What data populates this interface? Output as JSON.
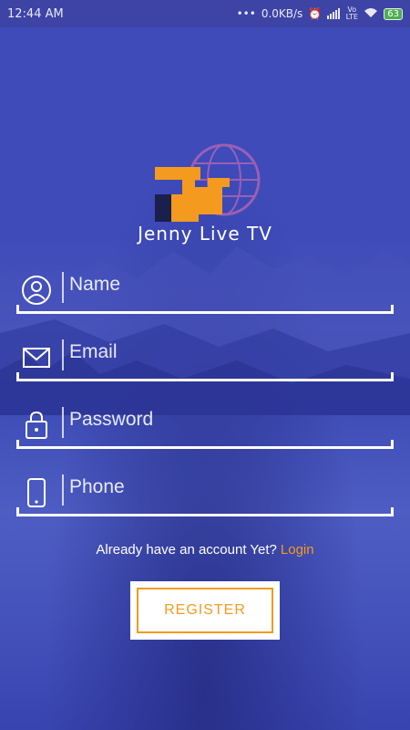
{
  "status_bar": {
    "time": "12:44 AM",
    "dots": "•••",
    "network_speed": "0.0KB/s",
    "volte": "Vo LTE",
    "battery": "63"
  },
  "app": {
    "title": "Jenny Live TV"
  },
  "form": {
    "name_placeholder": "Name",
    "email_placeholder": "Email",
    "password_placeholder": "Password",
    "phone_placeholder": "Phone"
  },
  "footer": {
    "already_text": "Already have an account Yet?",
    "login_link": "Login",
    "register_button": "REGISTER"
  },
  "colors": {
    "accent": "#f39a1f",
    "background": "#4250bb",
    "status_bar": "#3d44a6"
  }
}
